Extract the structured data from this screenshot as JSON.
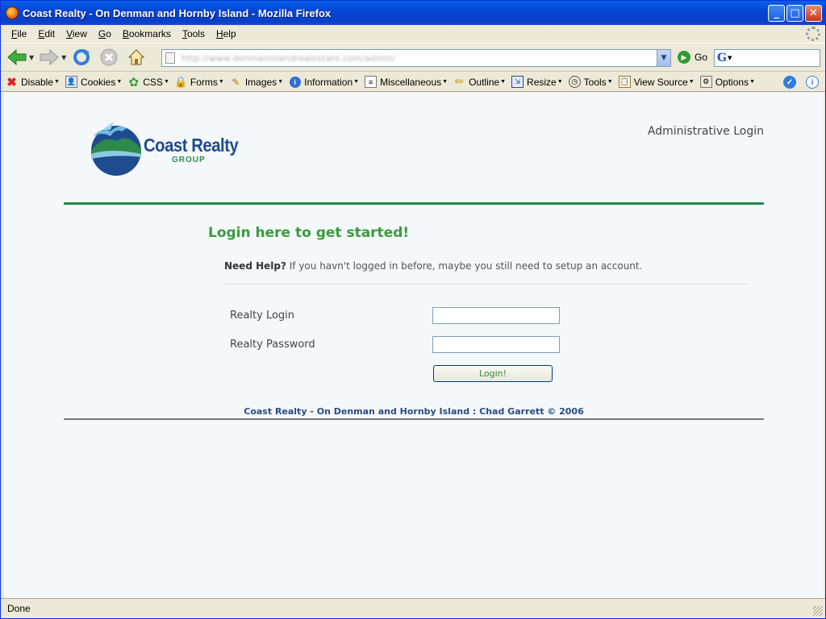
{
  "window": {
    "title": "Coast Realty - On Denman and Hornby Island - Mozilla Firefox",
    "controls": [
      "minimize",
      "maximize",
      "close"
    ]
  },
  "menubar": {
    "items": [
      {
        "label": "File",
        "accel": "F"
      },
      {
        "label": "Edit",
        "accel": "E"
      },
      {
        "label": "View",
        "accel": "V"
      },
      {
        "label": "Go",
        "accel": "G"
      },
      {
        "label": "Bookmarks",
        "accel": "B"
      },
      {
        "label": "Tools",
        "accel": "T"
      },
      {
        "label": "Help",
        "accel": "H"
      }
    ]
  },
  "navbar": {
    "url": "http://www.denmanislandrealestate.com/admin/",
    "go_label": "Go",
    "search_engine_icon": "G"
  },
  "devbar": {
    "items": [
      "Disable",
      "Cookies",
      "CSS",
      "Forms",
      "Images",
      "Information",
      "Miscellaneous",
      "Outline",
      "Resize",
      "Tools",
      "View Source",
      "Options"
    ]
  },
  "page": {
    "logo_name": "Coast Realty",
    "logo_sub": "GROUP",
    "admin_title": "Administrative Login",
    "heading": "Login here to get started!",
    "help_label": "Need Help?",
    "help_text": " If you havn't logged in before, maybe you still need to setup an account.",
    "login_label": "Realty Login",
    "login_value": "",
    "password_label": "Realty Password",
    "password_value": "",
    "submit_label": "Login!",
    "footer": "Coast Realty - On Denman and Hornby Island : Chad Garrett © 2006"
  },
  "status": {
    "text": "Done"
  },
  "colors": {
    "accent_green": "#3a9b3a",
    "rule_green": "#1a8a4a",
    "brand_blue": "#1f4b8f",
    "page_bg": "#f4f8fb"
  }
}
